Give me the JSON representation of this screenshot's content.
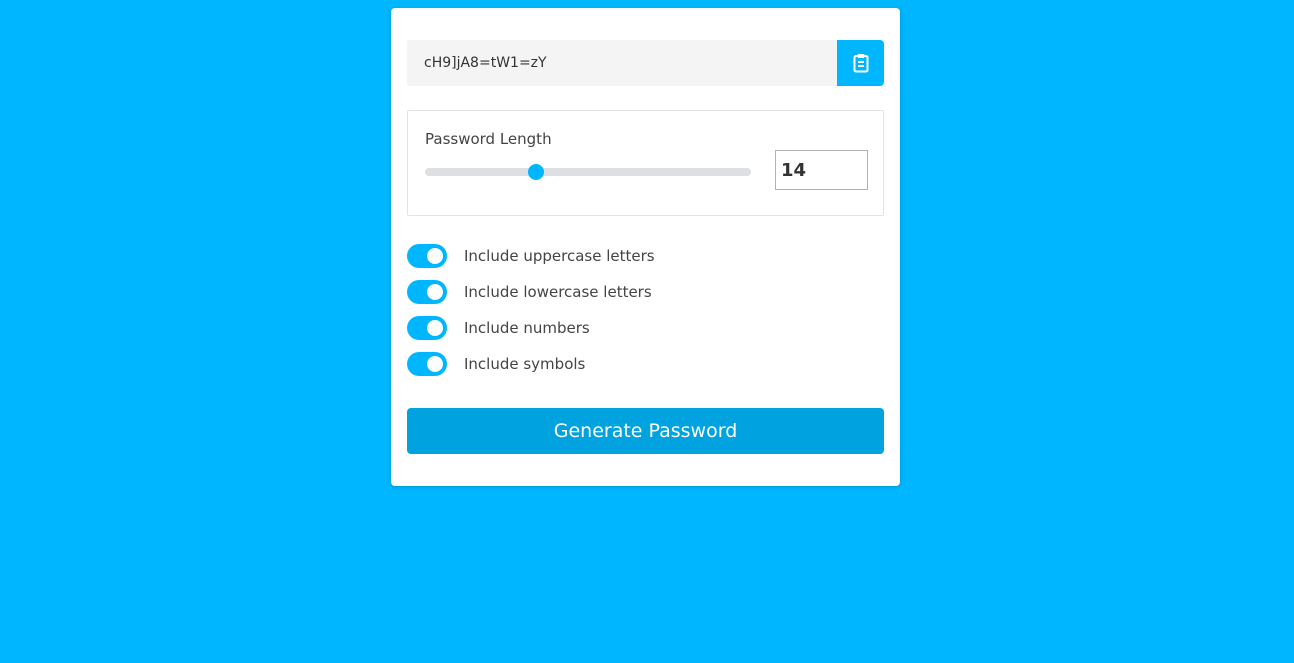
{
  "colors": {
    "background": "#00b6ff",
    "accent": "#00b6ff",
    "button": "#00a3e0"
  },
  "output": {
    "password": "cH9]jA8=tW1=zY",
    "copy_icon": "clipboard-icon"
  },
  "length": {
    "label": "Password Length",
    "value": "14",
    "slider_fraction": 0.34
  },
  "options": [
    {
      "label": "Include uppercase letters",
      "checked": true
    },
    {
      "label": "Include lowercase letters",
      "checked": true
    },
    {
      "label": "Include numbers",
      "checked": true
    },
    {
      "label": "Include symbols",
      "checked": true
    }
  ],
  "generate": {
    "label": "Generate Password"
  }
}
